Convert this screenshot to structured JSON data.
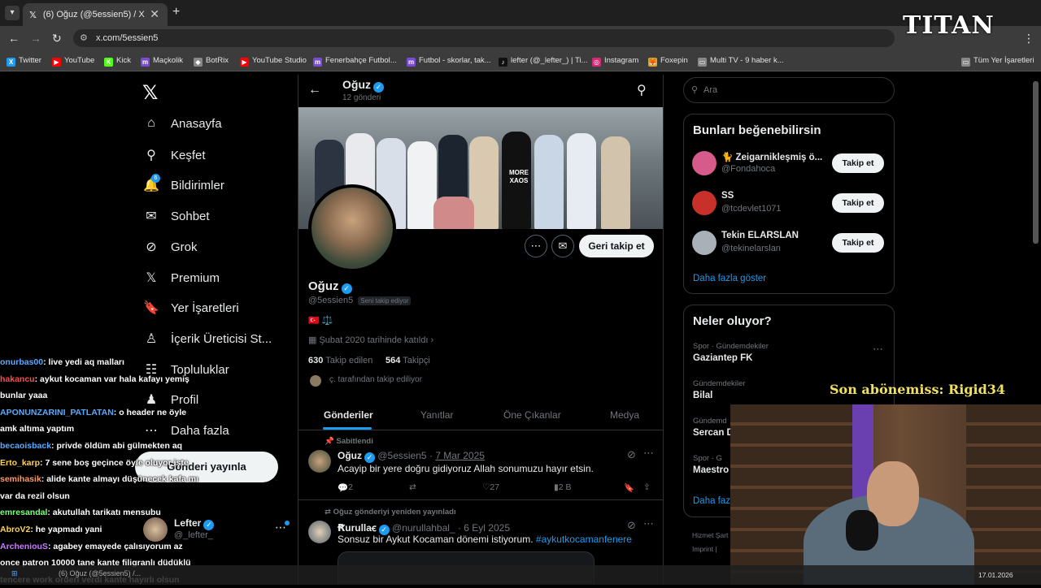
{
  "browser": {
    "tab_title": "(6) Oğuz (@5essien5) / X",
    "url": "x.com/5essien5",
    "bookmarks": [
      "Twitter",
      "YouTube",
      "Kick",
      "Maçkolik",
      "BotRix",
      "YouTube Studio",
      "Fenerbahçe Futbol...",
      "Futbol - skorlar, tak...",
      "lefter (@_lefter_) | Ti...",
      "Instagram",
      "Foxepin",
      "Multi TV - 9 haber k...",
      "Tüm Yer İşaretleri"
    ],
    "bookmark_colors": [
      "#1d9bf0",
      "#ff0000",
      "#53fc18",
      "#7b4bd6",
      "#888888",
      "#ff0000",
      "#7b4bd6",
      "#7b4bd6",
      "#111111",
      "#d62976",
      "#e0a020",
      "#888888",
      "#888888"
    ],
    "bookmark_glyphs": [
      "X",
      "▶",
      "K",
      "m",
      "◆",
      "▶",
      "m",
      "m",
      "♪",
      "◎",
      "🦊",
      "▭",
      "▭"
    ]
  },
  "stream": {
    "brand": "TITAN",
    "last_sub": "Son abönemiss: Rigid34",
    "chat": [
      {
        "user": "onurbas00",
        "color": "#5aa9ff",
        "text": ": live yedi aq malları"
      },
      {
        "user": "hakancu",
        "color": "#ff4d4d",
        "text": ": aykut kocaman var hala kafayı yemiş"
      },
      {
        "user": "",
        "color": "#ffffff",
        "text": "bunlar yaaa"
      },
      {
        "user": "APONUNZARINI_PATLATAN",
        "color": "#5aa9ff",
        "text": ": o header ne öyle"
      },
      {
        "user": "",
        "color": "#ffffff",
        "text": "amk altıma yaptım"
      },
      {
        "user": "becaoisback",
        "color": "#5aa9ff",
        "text": ": privde öldüm abi gülmekten aq"
      },
      {
        "user": "Erto_karp",
        "color": "#ffd24d",
        "text": ": 7 sene boş geçince öyle oluyor işte"
      },
      {
        "user": "semihasik",
        "color": "#ff9966",
        "text": ": alide kante almayı düşünecek kafa mı"
      },
      {
        "user": "",
        "color": "#ffffff",
        "text": "var da rezil olsun"
      },
      {
        "user": "emresandal",
        "color": "#7dff7d",
        "text": ": akutullah tarikatı mensubu"
      },
      {
        "user": "AbroV2",
        "color": "#ffd24d",
        "text": ": he yapmadı yani"
      },
      {
        "user": "ArcheniouS",
        "color": "#c77dff",
        "text": ": agabey emayede çalısıyorum az"
      },
      {
        "user": "",
        "color": "#ffffff",
        "text": "once patron 10000 tane kante filigranlı düdüklü"
      },
      {
        "user": "",
        "color": "#ffffff",
        "text": "tencere work orderi verdi kante hayırlı olsun"
      }
    ],
    "date": "17.01.2026"
  },
  "nav": {
    "items": [
      {
        "label": "Anasayfa",
        "icon": "home-icon",
        "glyph": "⌂"
      },
      {
        "label": "Keşfet",
        "icon": "search-icon",
        "glyph": "⚲"
      },
      {
        "label": "Bildirimler",
        "icon": "bell-icon",
        "glyph": "🔔"
      },
      {
        "label": "Sohbet",
        "icon": "mail-icon",
        "glyph": "✉"
      },
      {
        "label": "Grok",
        "icon": "grok-icon",
        "glyph": "⊘"
      },
      {
        "label": "Premium",
        "icon": "x-icon",
        "glyph": "𝕏"
      },
      {
        "label": "Yer İşaretleri",
        "icon": "bookmark-icon",
        "glyph": "🔖"
      },
      {
        "label": "İçerik Üreticisi St...",
        "icon": "creator-icon",
        "glyph": "♙"
      },
      {
        "label": "Topluluklar",
        "icon": "communities-icon",
        "glyph": "☷"
      },
      {
        "label": "Profil",
        "icon": "profile-icon",
        "glyph": "♟"
      },
      {
        "label": "Daha fazla",
        "icon": "more-icon",
        "glyph": "⋯"
      }
    ],
    "notif_badge": "6",
    "post_label": "Gönderi yayınla",
    "account_name": "Lefter",
    "account_handle": "@_lefter_"
  },
  "profile": {
    "name": "Oğuz",
    "post_count": "12 gönderi",
    "handle": "@5essien5",
    "follows_you": "Seni takip ediyor",
    "bio_emojis": "🇹🇷 ⚖️",
    "joined": "Şubat 2020 tarihinde katıldı",
    "following_count": "630",
    "following_label": "Takip edilen",
    "followers_count": "564",
    "followers_label": "Takipçi",
    "followed_by": "ç. tarafından takip ediliyor",
    "follow_back_label": "Geri takip et",
    "tabs": [
      "Gönderiler",
      "Yanıtlar",
      "Öne Çıkanlar",
      "Medya"
    ],
    "banner_text": "MORE XAOS"
  },
  "tweets": [
    {
      "context": "Sabitlendi",
      "name": "Oğuz",
      "handle": "@5essien5",
      "date": "7 Mar 2025",
      "text": "Acayip bir yere doğru gidiyoruz Allah sonumuzu hayır etsin.",
      "replies": "2",
      "reposts": "",
      "likes": "27",
      "views": "2 B"
    },
    {
      "context": "Oğuz gönderiyi yeniden yayınladı",
      "name": "Ꞧurullaꞓ",
      "handle": "@nurullahbal_",
      "date": "6 Eyl 2025",
      "text": "Sonsuz bir Aykut Kocaman dönemi istiyorum.",
      "hashtag": "#aykutkocamanfenere"
    }
  ],
  "right": {
    "search_placeholder": "Ara",
    "suggest_title": "Bunları beğenebilirsin",
    "suggestions": [
      {
        "name": "🐈 Zeigarnikleşmiş ö...",
        "handle": "@Fondahoca",
        "btn": "Takip et"
      },
      {
        "name": "SS",
        "handle": "@tcdevlet1071",
        "btn": "Takip et"
      },
      {
        "name": "Tekin ELARSLAN",
        "handle": "@tekinelarslan",
        "btn": "Takip et"
      }
    ],
    "show_more": "Daha fazla göster",
    "trends_title": "Neler oluyor?",
    "trends": [
      {
        "category": "Spor · Gündemdekiler",
        "title": "Gaziantep FK"
      },
      {
        "category": "Gündemdekiler",
        "title": "Bilal"
      },
      {
        "category": "Gündemd",
        "title": "Sercan D"
      },
      {
        "category": "Spor · G",
        "title": "Maestro"
      }
    ],
    "trends_more": "Daha faz",
    "footer1": "Hizmet Şart",
    "footer2": "Imprint  |"
  },
  "taskbar": {
    "item": "(6) Oğuz (@5essien5) /..."
  },
  "colors": {
    "accent": "#1d9bf0",
    "bg": "#000000",
    "border": "#2f3336",
    "muted": "#71767b"
  }
}
